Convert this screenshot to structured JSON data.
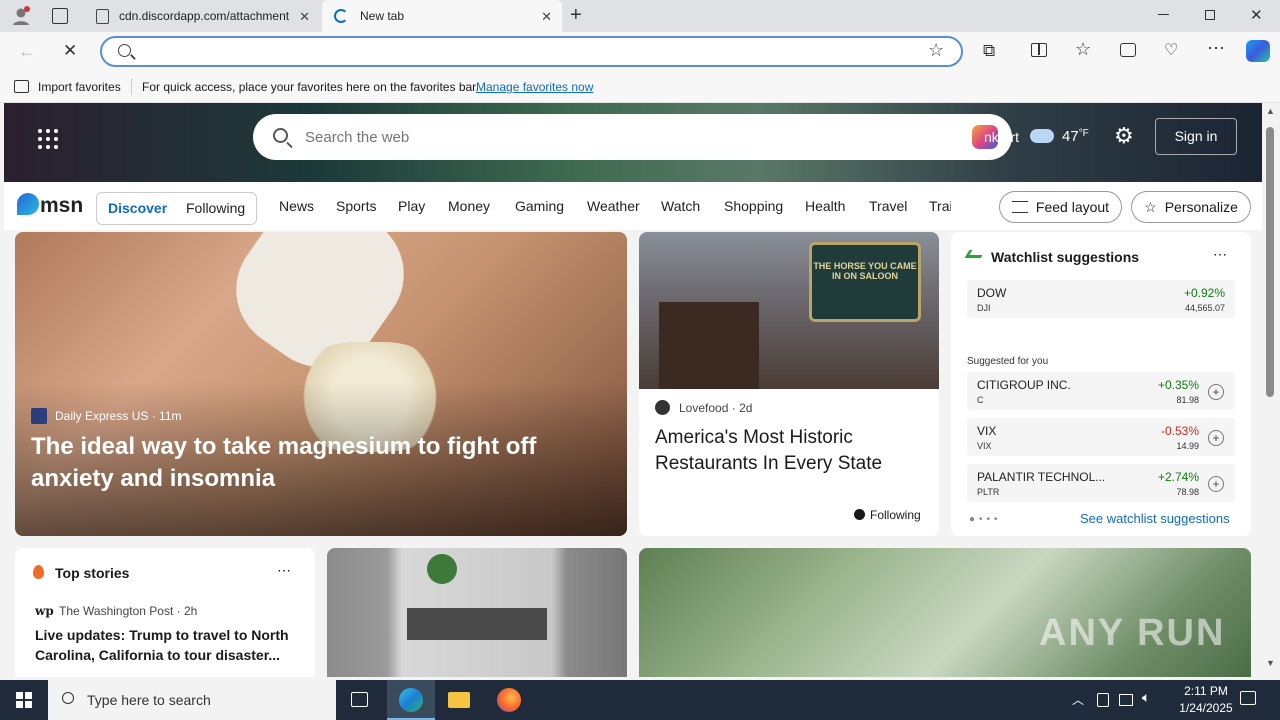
{
  "browser": {
    "tabs": [
      {
        "title": "cdn.discordapp.com/attachment"
      },
      {
        "title": "New tab"
      }
    ],
    "omnibox_value": "",
    "favbar": {
      "import_label": "Import favorites",
      "hint": "For quick access, place your favorites here on the favorites bar.",
      "manage_link": "Manage favorites now"
    }
  },
  "msn": {
    "search_placeholder": "Search the web",
    "weather_city": "nkfurt",
    "weather_temp": "47",
    "weather_unit": "°F",
    "sign_in": "Sign in",
    "logo_text": "msn",
    "tabs": {
      "discover": "Discover",
      "following": "Following"
    },
    "nav": [
      "News",
      "Sports",
      "Play",
      "Money",
      "Gaming",
      "Weather",
      "Watch",
      "Shopping",
      "Health",
      "Travel",
      "Trai"
    ],
    "feed_layout": "Feed layout",
    "personalize": "Personalize",
    "main_story": {
      "source": "Daily Express US",
      "age": "11m",
      "title": "The ideal way to take magnesium to fight off anxiety and insomnia"
    },
    "second_story": {
      "source": "Lovefood",
      "age": "2d",
      "title": "America's Most Historic Restaurants In Every State",
      "following": "Following",
      "sign_text": "THE HORSE YOU CAME IN ON SALOON"
    },
    "watchlist": {
      "title": "Watchlist suggestions",
      "suggested_label": "Suggested for you",
      "see_link": "See watchlist suggestions",
      "top": {
        "name": "DOW",
        "symbol": "DJI",
        "change": "+0.92%",
        "price": "44,565.07"
      },
      "items": [
        {
          "name": "CITIGROUP INC.",
          "symbol": "C",
          "change": "+0.35%",
          "price": "81.98",
          "dir": "up"
        },
        {
          "name": "VIX",
          "symbol": "VIX",
          "change": "-0.53%",
          "price": "14.99",
          "dir": "down"
        },
        {
          "name": "PALANTIR TECHNOL...",
          "symbol": "PLTR",
          "change": "+2.74%",
          "price": "78.98",
          "dir": "up"
        }
      ]
    },
    "top_stories": {
      "title": "Top stories",
      "source": "The Washington Post",
      "age": "2h",
      "headline": "Live updates: Trump to travel to North Carolina, California to tour disaster..."
    },
    "watermark": "ANY RUN"
  },
  "taskbar": {
    "search_placeholder": "Type here to search",
    "time": "2:11 PM",
    "date": "1/24/2025"
  },
  "colors": {
    "accent": "#0f6cbd",
    "up": "#0f7b0f",
    "down": "#c42b1c",
    "taskbar": "#1f2b3a"
  }
}
